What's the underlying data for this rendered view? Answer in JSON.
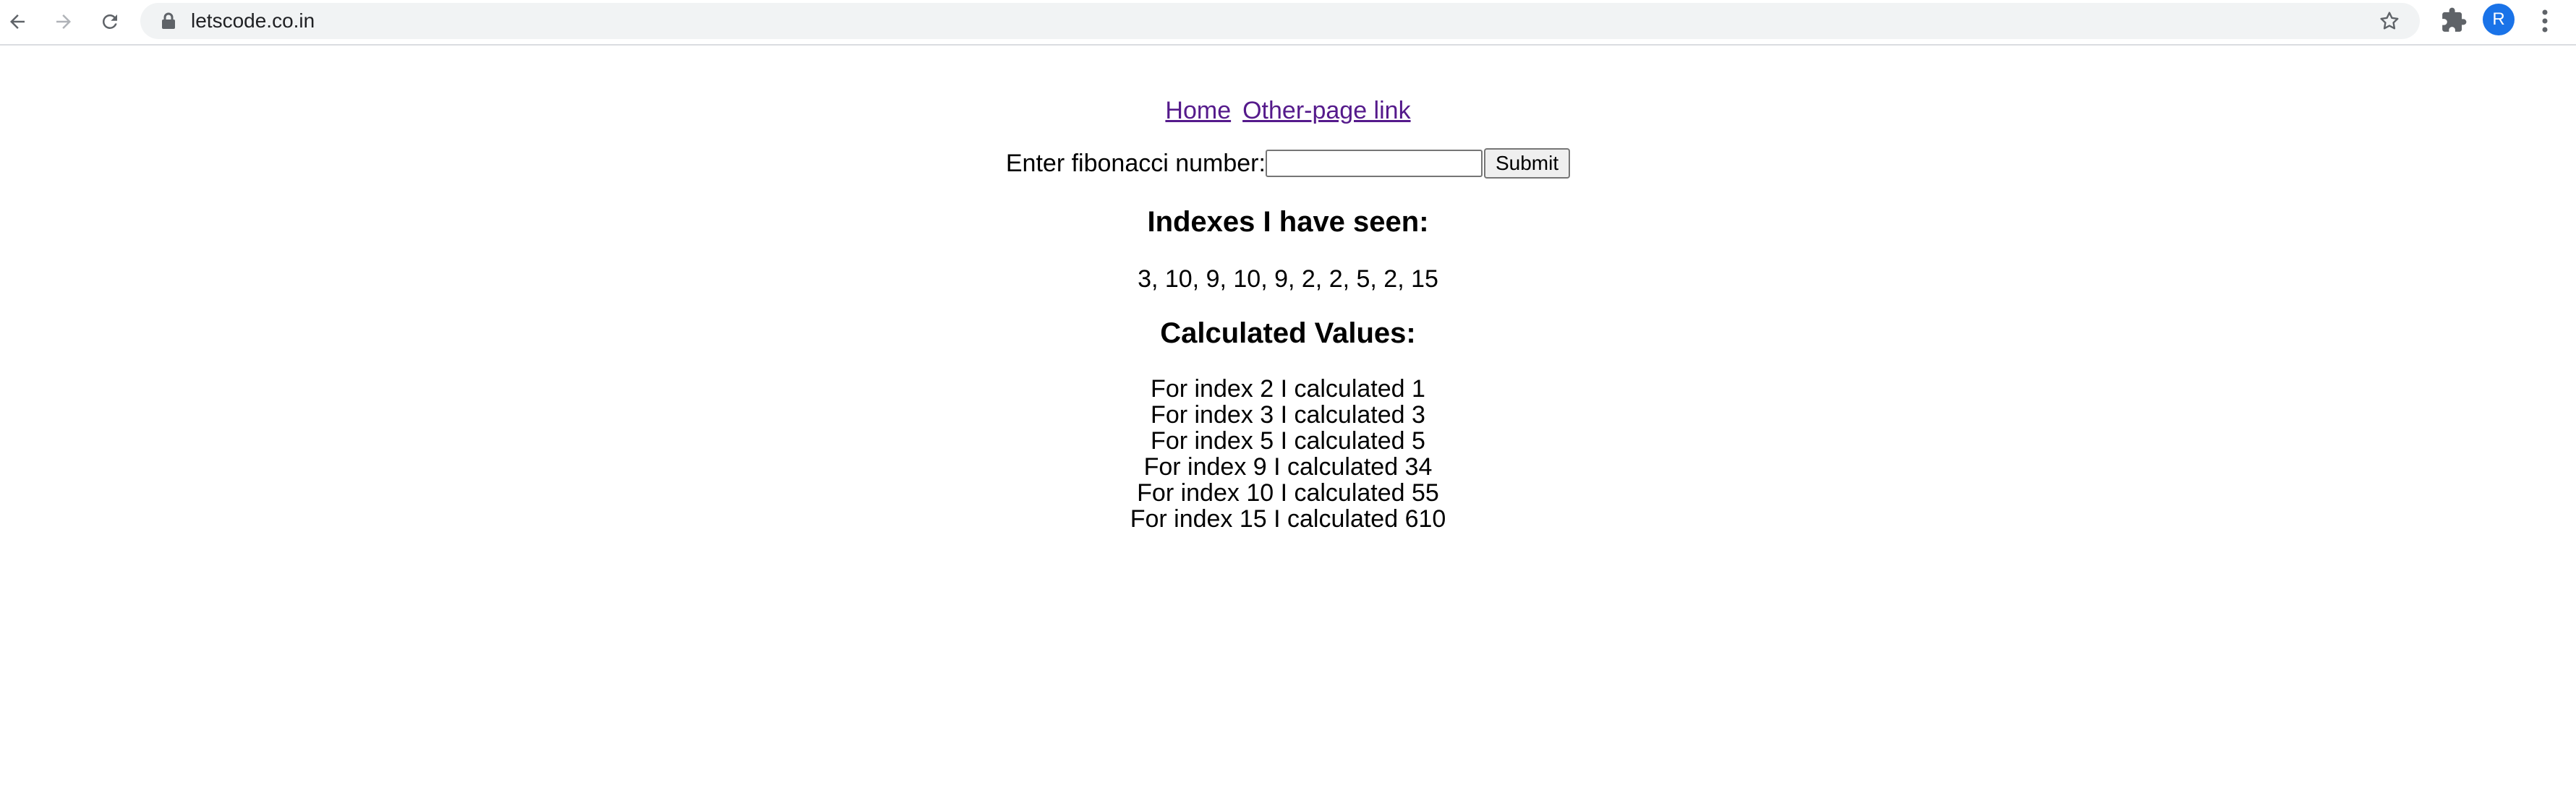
{
  "browser": {
    "url": "letscode.co.in",
    "profile_initial": "R",
    "icons": [
      "back-icon",
      "forward-icon",
      "reload-icon",
      "lock-icon",
      "star-icon",
      "extensions-icon",
      "menu-icon"
    ]
  },
  "nav": {
    "home_label": "Home",
    "other_label": "Other-page link"
  },
  "form": {
    "label": "Enter fibonacci number:",
    "input_value": "",
    "submit_label": "Submit"
  },
  "indexes": {
    "heading": "Indexes I have seen:",
    "list": "3, 10, 9, 10, 9, 2, 2, 5, 2, 15"
  },
  "values": {
    "heading": "Calculated Values:",
    "items": [
      "For index 2 I calculated 1",
      "For index 3 I calculated 3",
      "For index 5 I calculated 5",
      "For index 9 I calculated 34",
      "For index 10 I calculated 55",
      "For index 15 I calculated 610"
    ]
  },
  "colors": {
    "link": "#551a8b",
    "avatar": "#1a73e8",
    "omnibox": "#f1f3f4"
  }
}
